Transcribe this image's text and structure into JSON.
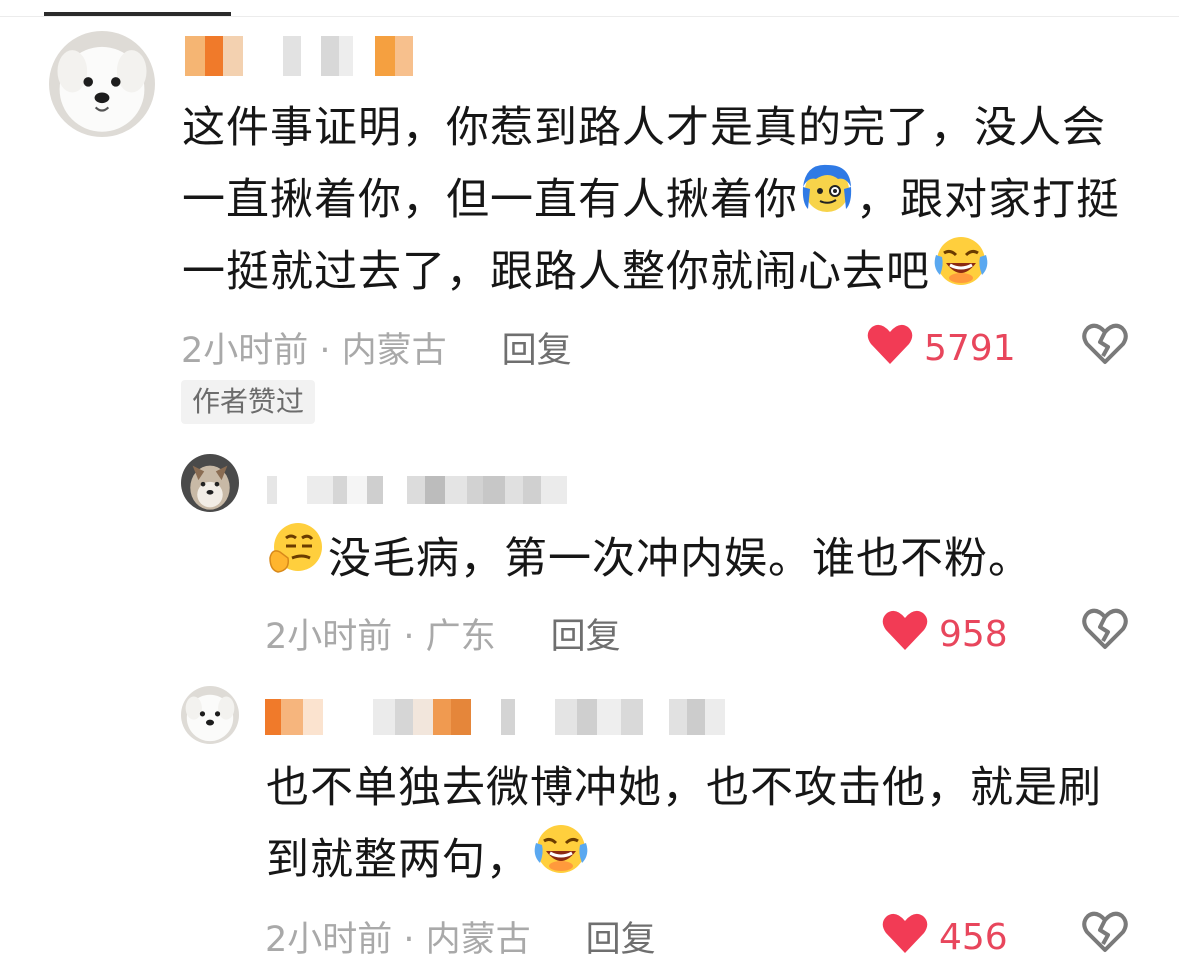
{
  "colors": {
    "like": "#e8465c",
    "meta": "#a9a9a9",
    "reply": "#6f6f6f",
    "text": "#161616"
  },
  "comments": [
    {
      "avatar": "white-dog-avatar",
      "username_blurred": true,
      "text_lines": [
        "这件事证明，你惹到路人才是真的完了，没人会",
        "一直揪着你，但一直有人揪着你",
        "，跟对家打挺",
        "一挺就过去了，跟路人整你就闹心去吧"
      ],
      "time_location": "2小时前 · 内蒙古",
      "reply_label": "回复",
      "likes": "5791",
      "author_liked": "作者赞过"
    },
    {
      "avatar": "husky-dog-avatar",
      "username_blurred": true,
      "text": "没毛病，第一次冲内娱。谁也不粉。",
      "time_location": "2小时前 · 广东",
      "reply_label": "回复",
      "likes": "958"
    },
    {
      "avatar": "white-dog-avatar",
      "username_blurred": true,
      "text_lines": [
        "也不单独去微博冲她，也不攻击他，就是刷",
        "到就整两句，"
      ],
      "time_location": "2小时前 · 内蒙古",
      "reply_label": "回复",
      "likes": "456"
    }
  ]
}
